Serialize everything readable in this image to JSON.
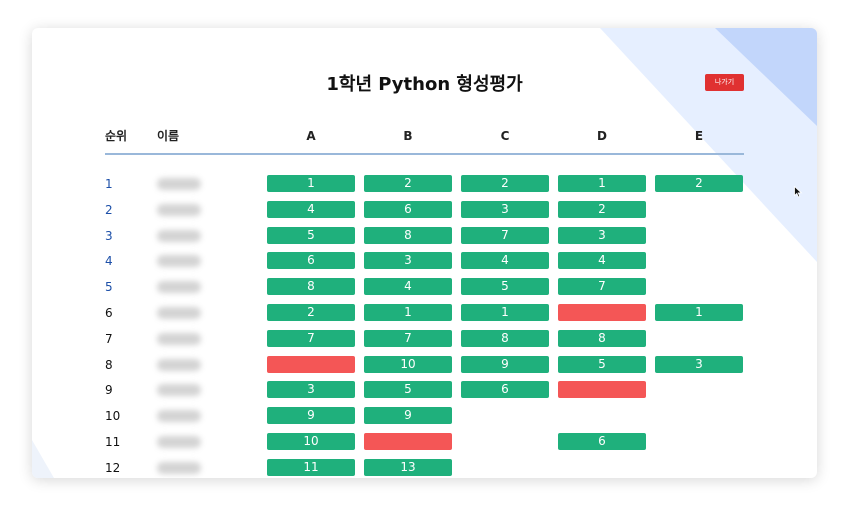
{
  "page": {
    "title": "1학년 Python 형성평가",
    "exit_label": "나가기"
  },
  "table": {
    "headers": {
      "rank": "순위",
      "name": "이름",
      "problems": [
        "A",
        "B",
        "C",
        "D",
        "E"
      ]
    },
    "rows": [
      {
        "rank": "1",
        "scores": [
          "1",
          "2",
          "2",
          "1",
          "2"
        ]
      },
      {
        "rank": "2",
        "scores": [
          "4",
          "6",
          "3",
          "2",
          null
        ]
      },
      {
        "rank": "3",
        "scores": [
          "5",
          "8",
          "7",
          "3",
          null
        ]
      },
      {
        "rank": "4",
        "scores": [
          "6",
          "3",
          "4",
          "4",
          null
        ]
      },
      {
        "rank": "5",
        "scores": [
          "8",
          "4",
          "5",
          "7",
          null
        ]
      },
      {
        "rank": "6",
        "scores": [
          "2",
          "1",
          "1",
          "",
          "1"
        ]
      },
      {
        "rank": "7",
        "scores": [
          "7",
          "7",
          "8",
          "8",
          null
        ]
      },
      {
        "rank": "8",
        "scores": [
          "",
          "10",
          "9",
          "5",
          "3"
        ]
      },
      {
        "rank": "9",
        "scores": [
          "3",
          "5",
          "6",
          "",
          null
        ]
      },
      {
        "rank": "10",
        "scores": [
          "9",
          "9",
          null,
          null,
          null
        ]
      },
      {
        "rank": "11",
        "scores": [
          "10",
          "",
          null,
          "6",
          null
        ]
      },
      {
        "rank": "12",
        "scores": [
          "11",
          "13",
          null,
          null,
          null
        ]
      }
    ]
  },
  "colors": {
    "solved": "#1fb07c",
    "failed": "#f45656",
    "exit": "#e03131",
    "top_rank": "#1c4fa8"
  },
  "icons": {
    "cursor": "mouse-pointer-icon"
  }
}
